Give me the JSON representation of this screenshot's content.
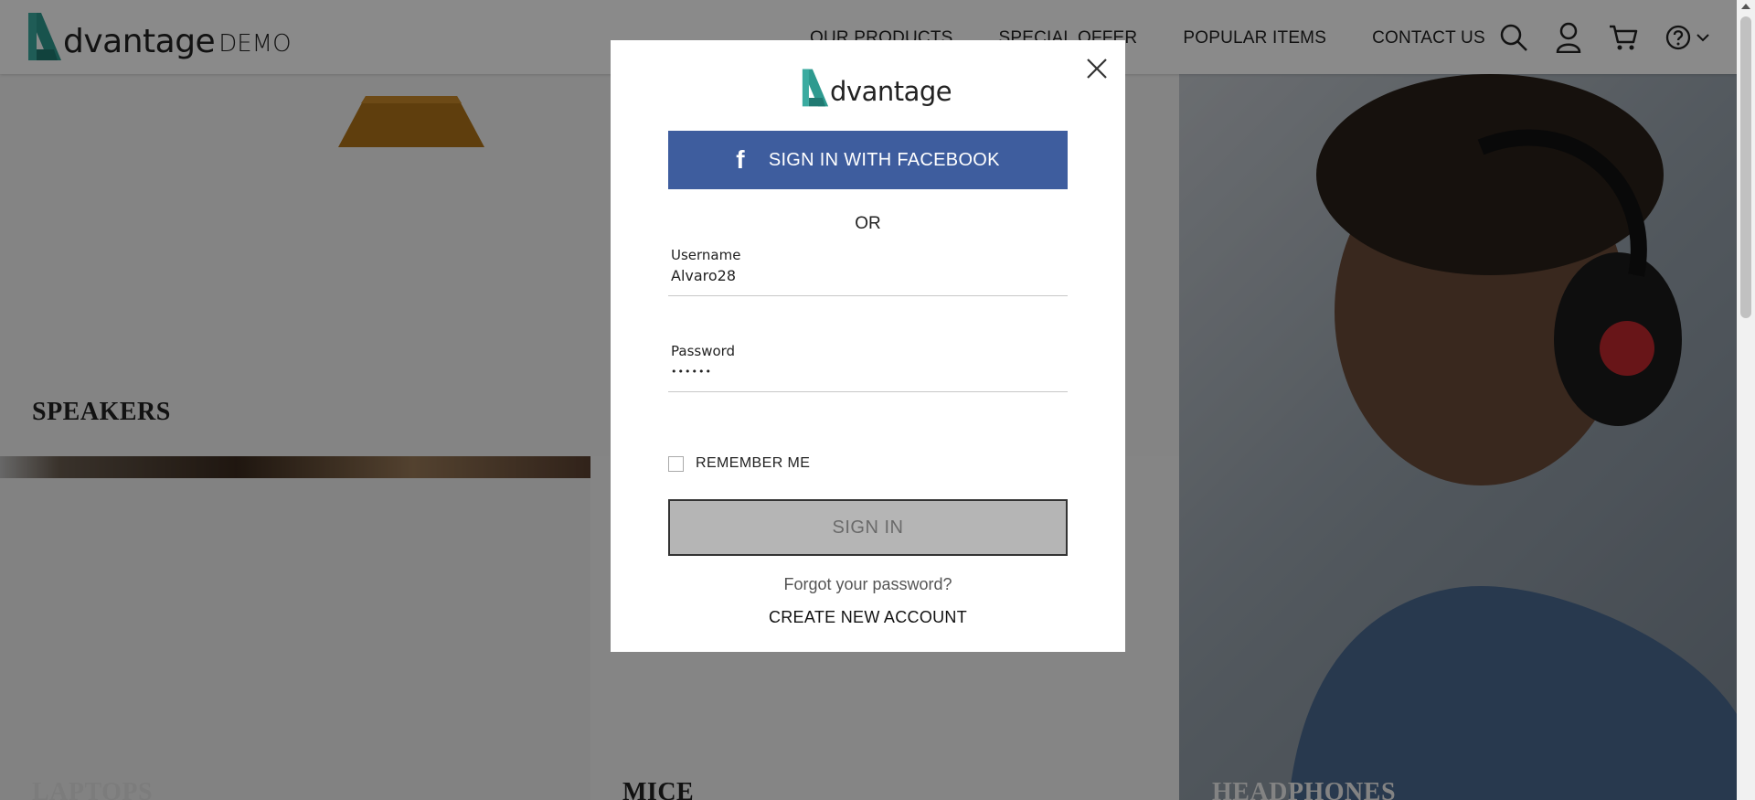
{
  "brand": {
    "wordmark": "dvantage",
    "demo": "DEMO"
  },
  "nav": {
    "items": [
      {
        "label": "OUR PRODUCTS"
      },
      {
        "label": "SPECIAL OFFER"
      },
      {
        "label": "POPULAR ITEMS"
      },
      {
        "label": "CONTACT US"
      }
    ],
    "icons": [
      "search-icon",
      "user-icon",
      "cart-icon",
      "help-icon",
      "chevron-down-icon"
    ]
  },
  "categories": {
    "speakers": "SPEAKERS",
    "laptops": "LAPTOPS",
    "mice": "MICE",
    "headphones": "HEADPHONES"
  },
  "login": {
    "logo": "dvantage",
    "facebook_label": "SIGN IN WITH FACEBOOK",
    "or_label": "OR",
    "username_label": "Username",
    "username_value": "Alvaro28",
    "password_label": "Password",
    "password_value": "••••••",
    "remember_label": "REMEMBER ME",
    "signin_label": "SIGN IN",
    "forgot_label": "Forgot your password?",
    "create_label": "CREATE NEW ACCOUNT"
  },
  "colors": {
    "brand_teal": "#2e9a8f",
    "facebook_blue": "#3e5d9e",
    "overlay": "rgba(0,0,0,0.46)"
  }
}
